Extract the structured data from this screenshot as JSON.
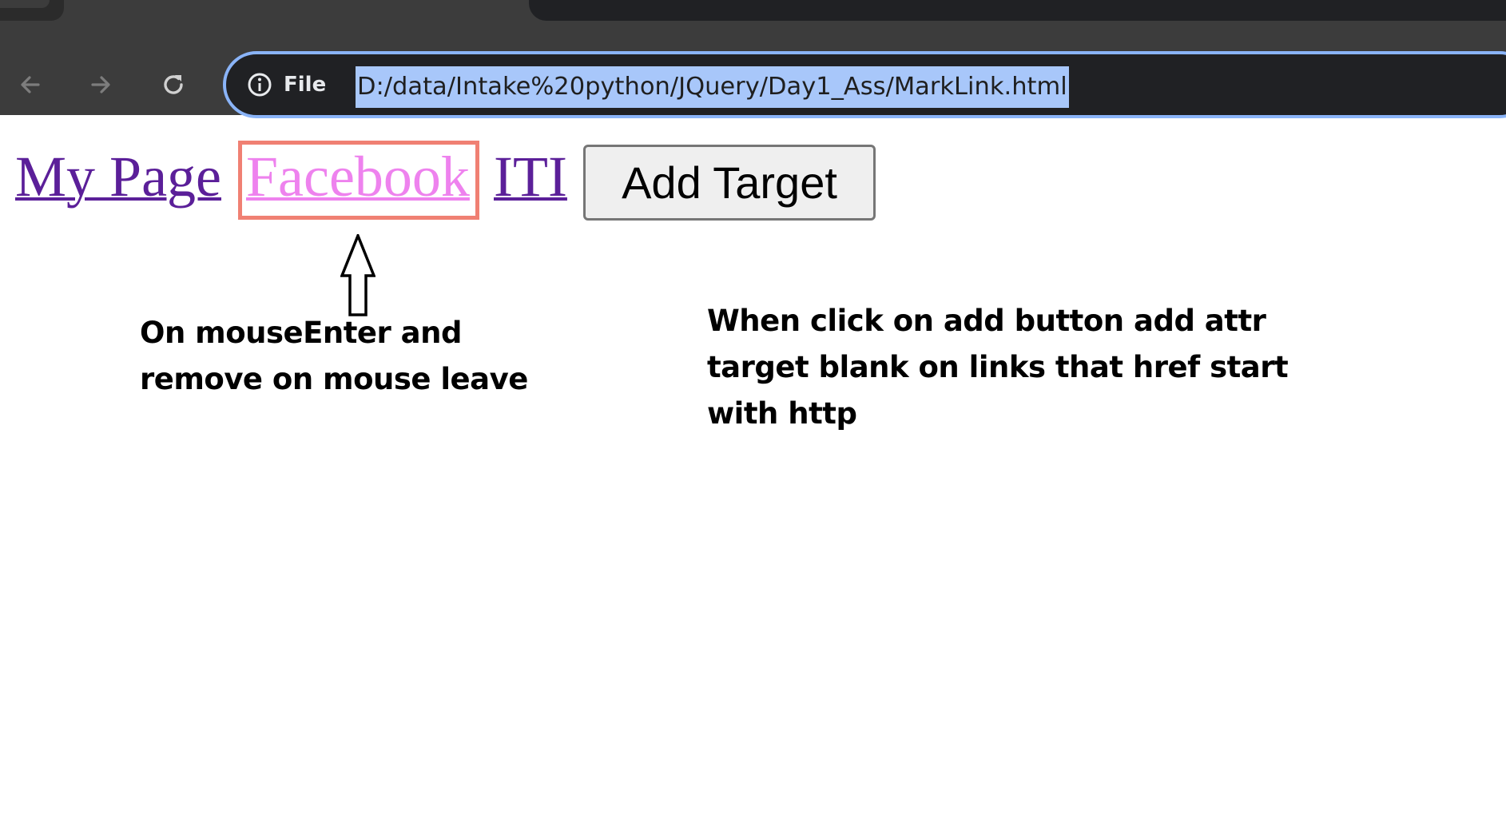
{
  "browser": {
    "omnibox": {
      "scheme_label": "File",
      "url": "D:/data/Intake%20python/JQuery/Day1_Ass/MarkLink.html"
    },
    "icons": {
      "back": "back-arrow-icon",
      "forward": "forward-arrow-icon",
      "reload": "reload-icon",
      "site_info": "info-icon"
    }
  },
  "page": {
    "links": [
      {
        "label": "My Page"
      },
      {
        "label": "Facebook",
        "hover_border_color": "#f08073",
        "hover_text_color": "#ee82ee"
      },
      {
        "label": "ITI"
      }
    ],
    "add_target_button": "Add Target",
    "notes": {
      "hover_note_line1": "On mouseEnter and",
      "hover_note_line2": "remove on mouse leave",
      "button_note_line1": "When click on add button add attr",
      "button_note_line2": "target blank on links that href start",
      "button_note_line3": "with http"
    },
    "link_color": "#5b1f99"
  }
}
